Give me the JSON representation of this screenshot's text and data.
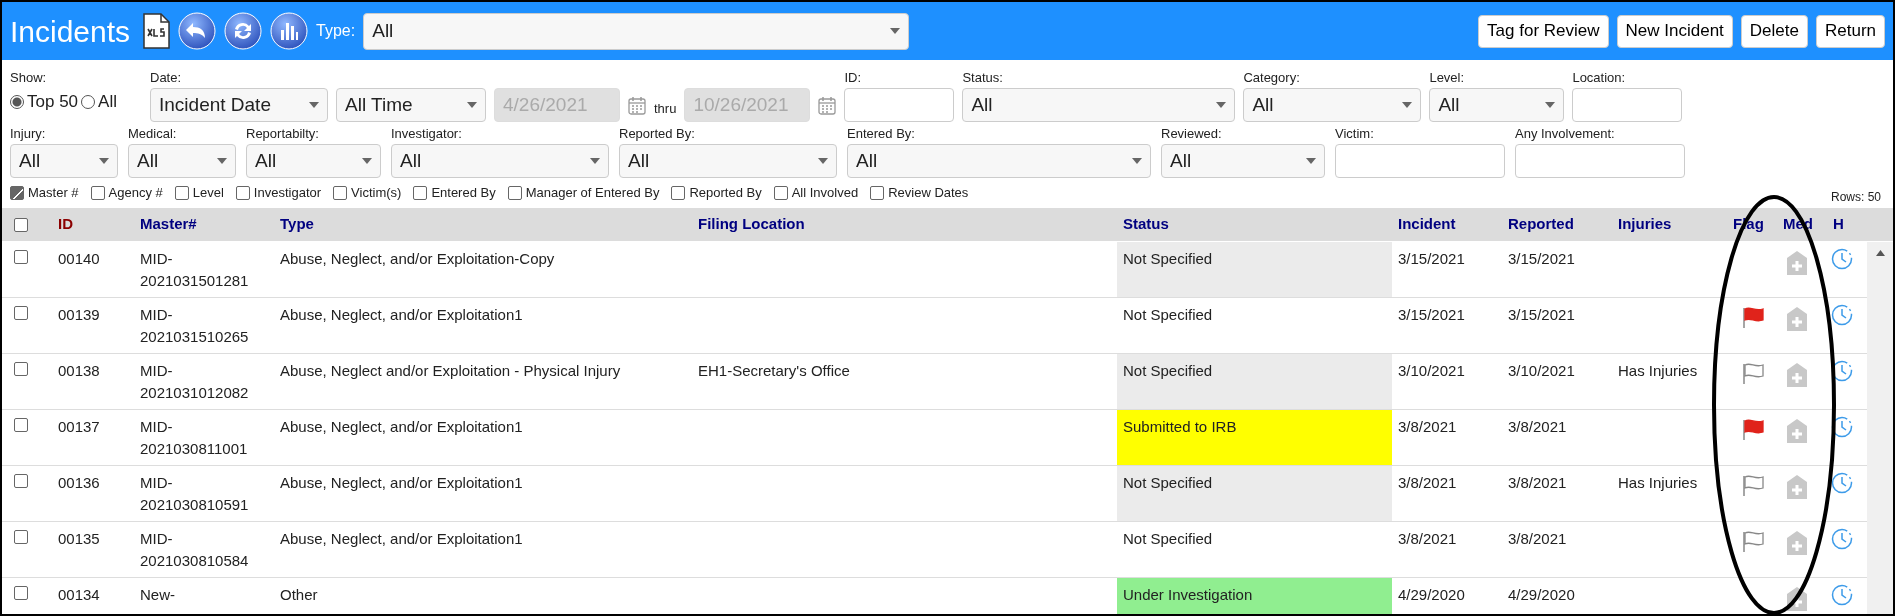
{
  "header": {
    "title": "Incidents",
    "type_label": "Type:",
    "type_value": "All",
    "buttons": [
      "Tag for Review",
      "New Incident",
      "Delete",
      "Return"
    ]
  },
  "filters": {
    "show_label": "Show:",
    "show_options": [
      {
        "label": "Top 50",
        "selected": true
      },
      {
        "label": "All",
        "selected": false
      }
    ],
    "row1": [
      {
        "kind": "date",
        "label": "Date:",
        "select1": "Incident Date",
        "select2": "All Time",
        "from": "4/26/2021",
        "thru": "thru",
        "to": "10/26/2021"
      },
      {
        "kind": "input",
        "label": "ID:"
      },
      {
        "kind": "select",
        "label": "Status:",
        "value": "All"
      },
      {
        "kind": "select",
        "label": "Category:",
        "value": "All"
      },
      {
        "kind": "select",
        "label": "Level:",
        "value": "All"
      },
      {
        "kind": "input",
        "label": "Location:"
      }
    ],
    "row2": [
      {
        "kind": "select",
        "label": "Injury:",
        "value": "All"
      },
      {
        "kind": "select",
        "label": "Medical:",
        "value": "All"
      },
      {
        "kind": "select",
        "label": "Reportabilty:",
        "value": "All"
      },
      {
        "kind": "select",
        "label": "Investigator:",
        "value": "All"
      },
      {
        "kind": "select",
        "label": "Reported By:",
        "value": "All"
      },
      {
        "kind": "select",
        "label": "Entered By:",
        "value": "All"
      },
      {
        "kind": "select",
        "label": "Reviewed:",
        "value": "All"
      },
      {
        "kind": "input",
        "label": "Victim:"
      },
      {
        "kind": "input",
        "label": "Any Involvement:"
      }
    ],
    "columns_toggles": [
      {
        "label": "Master #",
        "checked": true
      },
      {
        "label": "Agency #",
        "checked": false
      },
      {
        "label": "Level",
        "checked": false
      },
      {
        "label": "Investigator",
        "checked": false
      },
      {
        "label": "Victim(s)",
        "checked": false
      },
      {
        "label": "Entered By",
        "checked": false
      },
      {
        "label": "Manager of Entered By",
        "checked": false
      },
      {
        "label": "Reported By",
        "checked": false
      },
      {
        "label": "All Involved",
        "checked": false
      },
      {
        "label": "Review Dates",
        "checked": false
      }
    ],
    "rows_count": "Rows: 50"
  },
  "table": {
    "select_all_checked": false,
    "columns": [
      "ID",
      "Master#",
      "Type",
      "Filing Location",
      "Status",
      "Incident",
      "Reported",
      "Injuries",
      "Flag",
      "Med",
      "H"
    ],
    "rows": [
      {
        "checked": false,
        "id": "00140",
        "master": "MID-2021031501281",
        "type": "Abuse, Neglect, and/or Exploitation-Copy",
        "filing": "",
        "status": "Not Specified",
        "color": "#ebebeb",
        "incident": "3/15/2021",
        "reported": "3/15/2021",
        "injuries": "",
        "flag_shown": false
      },
      {
        "checked": false,
        "id": "00139",
        "master": "MID-2021031510265",
        "type": "Abuse, Neglect, and/or Exploitation1",
        "filing": "",
        "status": "Not Specified",
        "color": "#ffffff",
        "incident": "3/15/2021",
        "reported": "3/15/2021",
        "injuries": "",
        "flag_shown": true,
        "flagged": true
      },
      {
        "checked": false,
        "id": "00138",
        "master": "MID-2021031012082",
        "type": "Abuse, Neglect and/or Exploitation - Physical Injury",
        "filing": "EH1-Secretary's Office",
        "status": "Not Specified",
        "color": "#ebebeb",
        "incident": "3/10/2021",
        "reported": "3/10/2021",
        "injuries": "Has Injuries",
        "flag_shown": true,
        "flagged": false
      },
      {
        "checked": false,
        "id": "00137",
        "master": "MID-2021030811001",
        "type": "Abuse, Neglect, and/or Exploitation1",
        "filing": "",
        "status": "Submitted to IRB",
        "color": "#ffff00",
        "incident": "3/8/2021",
        "reported": "3/8/2021",
        "injuries": "",
        "flag_shown": true,
        "flagged": true
      },
      {
        "checked": false,
        "id": "00136",
        "master": "MID-2021030810591",
        "type": "Abuse, Neglect, and/or Exploitation1",
        "filing": "",
        "status": "Not Specified",
        "color": "#ebebeb",
        "incident": "3/8/2021",
        "reported": "3/8/2021",
        "injuries": "Has Injuries",
        "flag_shown": true,
        "flagged": false
      },
      {
        "checked": false,
        "id": "00135",
        "master": "MID-2021030810584",
        "type": "Abuse, Neglect, and/or Exploitation1",
        "filing": "",
        "status": "Not Specified",
        "color": "#ffffff",
        "incident": "3/8/2021",
        "reported": "3/8/2021",
        "injuries": "",
        "flag_shown": true,
        "flagged": false
      },
      {
        "checked": false,
        "id": "00134",
        "master": "New-",
        "type": "Other",
        "filing": "",
        "status": "Under Investigation",
        "color": "#90ee90",
        "incident": "4/29/2020",
        "reported": "4/29/2020",
        "injuries": "",
        "flag_shown": false
      }
    ]
  }
}
